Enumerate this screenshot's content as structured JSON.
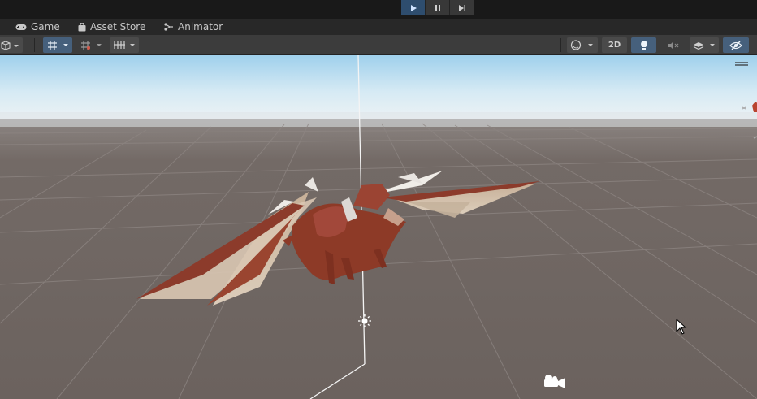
{
  "playmode": {
    "play_icon": "play-icon",
    "pause_icon": "pause-icon",
    "step_icon": "step-icon",
    "play_active": true
  },
  "tabs": [
    {
      "label": "Game",
      "icon": "gamepad-icon"
    },
    {
      "label": "Asset Store",
      "icon": "shopping-bag-icon"
    },
    {
      "label": "Animator",
      "icon": "animator-icon"
    }
  ],
  "toolbar": {
    "left": [
      {
        "name": "draw-mode-cube",
        "icon": "cube-icon"
      },
      {
        "name": "grid-snapping",
        "icon": "grid-snap-icon"
      },
      {
        "name": "increment-snap",
        "icon": "increment-snap-icon"
      },
      {
        "name": "ruler-toggle",
        "icon": "ruler-icon"
      }
    ],
    "right": {
      "shading_icon": "sphere-icon",
      "mode_2d_label": "2D",
      "lighting_icon": "lightbulb-icon",
      "audio_icon": "audio-mute-icon",
      "effects_icon": "effects-icon",
      "visibility_icon": "eye-hidden-icon"
    }
  },
  "scene": {
    "sky_top": "#a8d4ee",
    "horizon": "#ecf2f4",
    "ground": "#6e6560",
    "grid_line": "#8b8380",
    "dragon_color": "#8a3a2a",
    "gizmo_light_icon": "sun-icon",
    "gizmo_camera_icon": "camera-icon",
    "menu_icon": "hamburger-icon",
    "cursor_icon": "mouse-cursor-icon"
  }
}
